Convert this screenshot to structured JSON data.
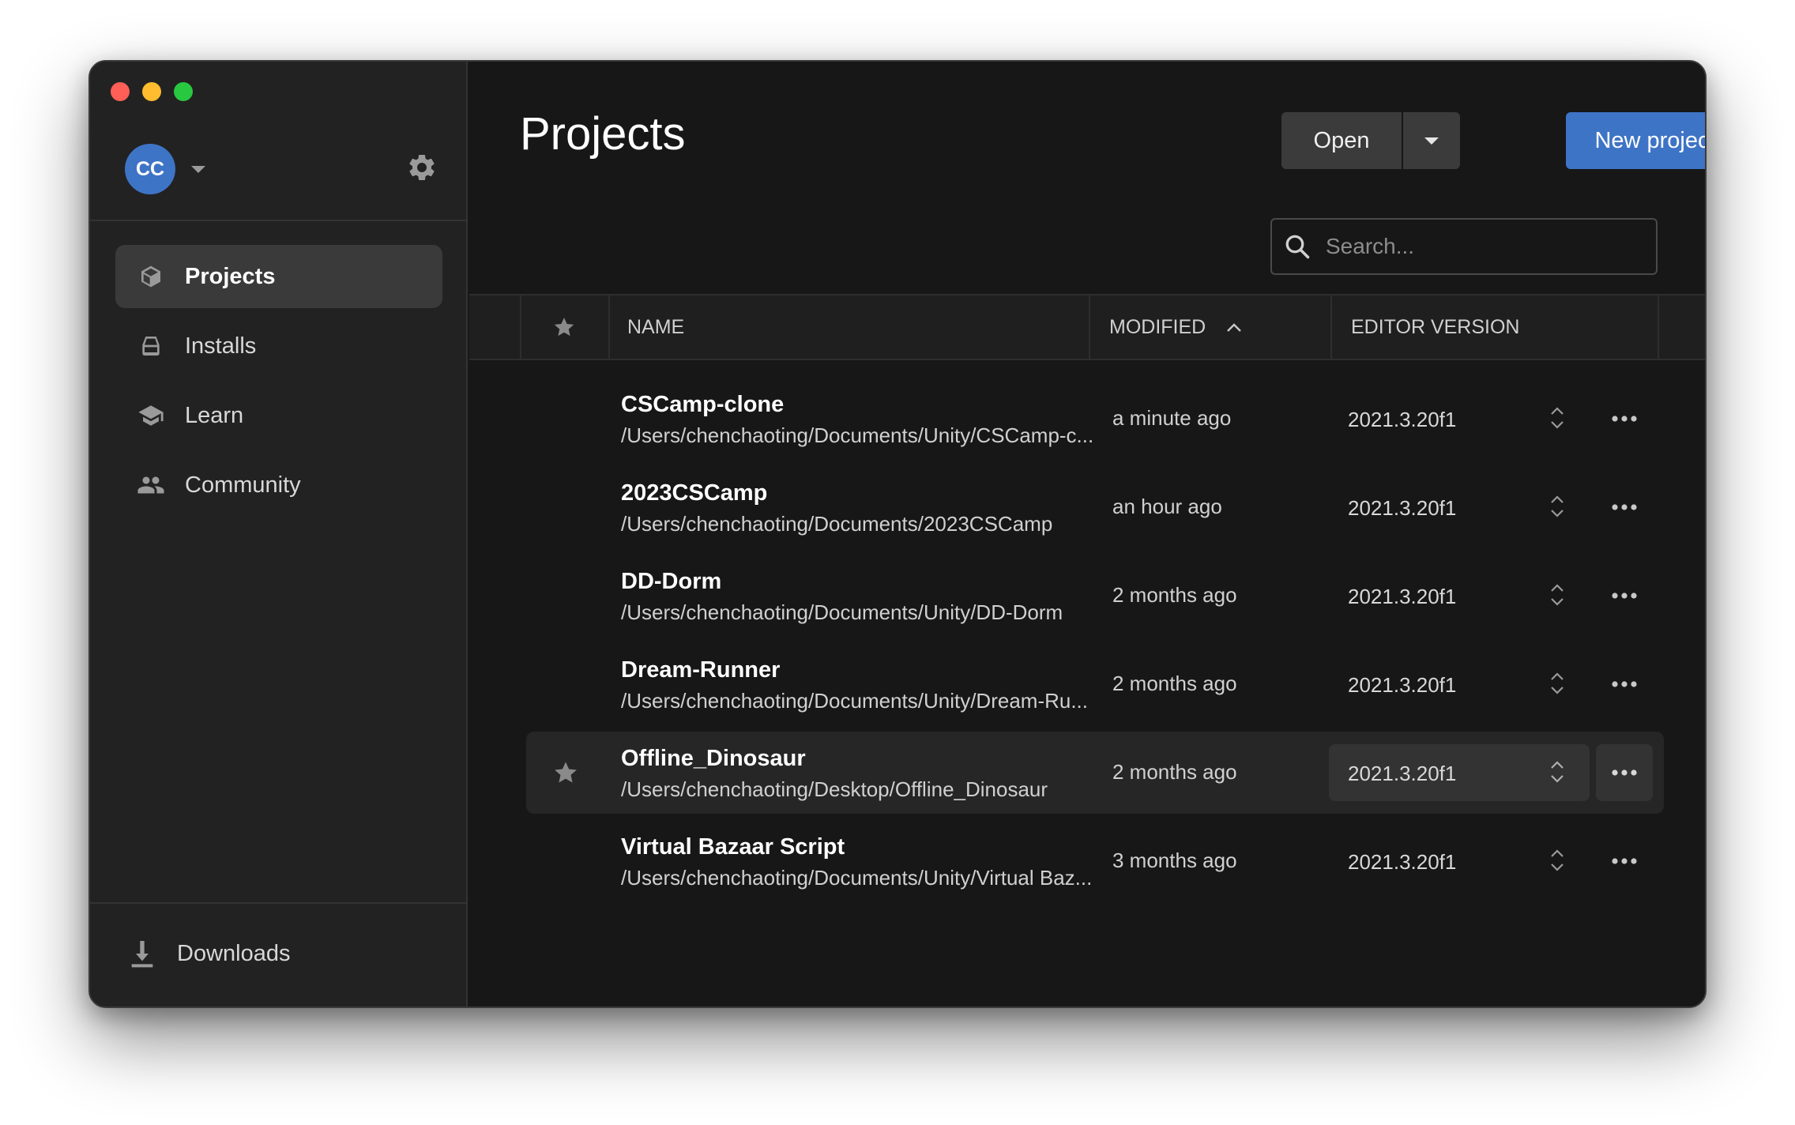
{
  "sidebar": {
    "account_initials": "CC",
    "nav": [
      {
        "label": "Projects",
        "icon": "cube-icon",
        "active": true
      },
      {
        "label": "Installs",
        "icon": "disk-icon",
        "active": false
      },
      {
        "label": "Learn",
        "icon": "graduation-cap-icon",
        "active": false
      },
      {
        "label": "Community",
        "icon": "people-icon",
        "active": false
      }
    ],
    "downloads_label": "Downloads"
  },
  "header": {
    "title": "Projects",
    "open_label": "Open",
    "new_project_label": "New project"
  },
  "search": {
    "placeholder": "Search..."
  },
  "table": {
    "columns": {
      "name": "NAME",
      "modified": "MODIFIED",
      "editor_version": "EDITOR VERSION"
    },
    "sort": {
      "column": "modified",
      "direction": "ascending"
    },
    "rows": [
      {
        "name": "CSCamp-clone",
        "path": "/Users/chenchaoting/Documents/Unity/CSCamp-c...",
        "modified": "a minute ago",
        "version": "2021.3.20f1",
        "favorite": false
      },
      {
        "name": "2023CSCamp",
        "path": "/Users/chenchaoting/Documents/2023CSCamp",
        "modified": "an hour ago",
        "version": "2021.3.20f1",
        "favorite": false
      },
      {
        "name": "DD-Dorm",
        "path": "/Users/chenchaoting/Documents/Unity/DD-Dorm",
        "modified": "2 months ago",
        "version": "2021.3.20f1",
        "favorite": false
      },
      {
        "name": "Dream-Runner",
        "path": "/Users/chenchaoting/Documents/Unity/Dream-Ru...",
        "modified": "2 months ago",
        "version": "2021.3.20f1",
        "favorite": false
      },
      {
        "name": "Offline_Dinosaur",
        "path": "/Users/chenchaoting/Desktop/Offline_Dinosaur",
        "modified": "2 months ago",
        "version": "2021.3.20f1",
        "favorite": false,
        "hovered": true
      },
      {
        "name": "Virtual Bazaar Script",
        "path": "/Users/chenchaoting/Documents/Unity/Virtual Baz...",
        "modified": "3 months ago",
        "version": "2021.3.20f1",
        "favorite": false
      }
    ]
  },
  "colors": {
    "accent": "#3e74c6",
    "window_bg": "#171717",
    "sidebar_bg": "#222222",
    "traffic_red": "#ff5f57",
    "traffic_yellow": "#febc2e",
    "traffic_green": "#28c840"
  }
}
